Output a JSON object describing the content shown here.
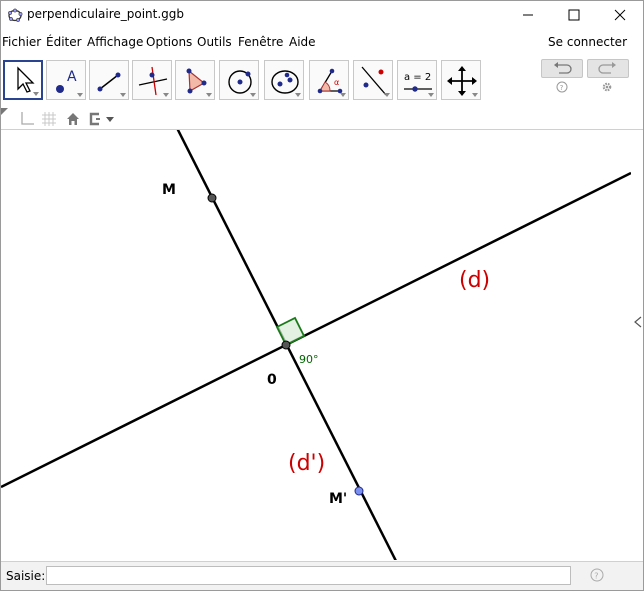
{
  "window": {
    "title": "perpendiculaire_point.ggb"
  },
  "menu": {
    "items": [
      "Fichier",
      "Éditer",
      "Affichage",
      "Options",
      "Outils",
      "Fenêtre",
      "Aide"
    ],
    "login": "Se connecter"
  },
  "toolbar": {
    "tools": [
      "move-tool",
      "point-tool",
      "line-tool",
      "perpendicular-line-tool",
      "polygon-tool",
      "circle-tool",
      "conic-tool",
      "angle-tool",
      "reflect-tool",
      "slider-tool",
      "move-graphics-view-tool"
    ],
    "slider_label": "a = 2",
    "angle_symbol": "α"
  },
  "graphics": {
    "point_M": "M",
    "point_O": "0",
    "point_M_prime": "M'",
    "line_d": "(d)",
    "line_d_prime": "(d')",
    "angle": "90°",
    "colors": {
      "line": "#000000",
      "label_red": "#cc0000",
      "angle_green": "#006400",
      "point_blue": "#4a6ee0"
    }
  },
  "input": {
    "label": "Saisie:",
    "value": ""
  }
}
